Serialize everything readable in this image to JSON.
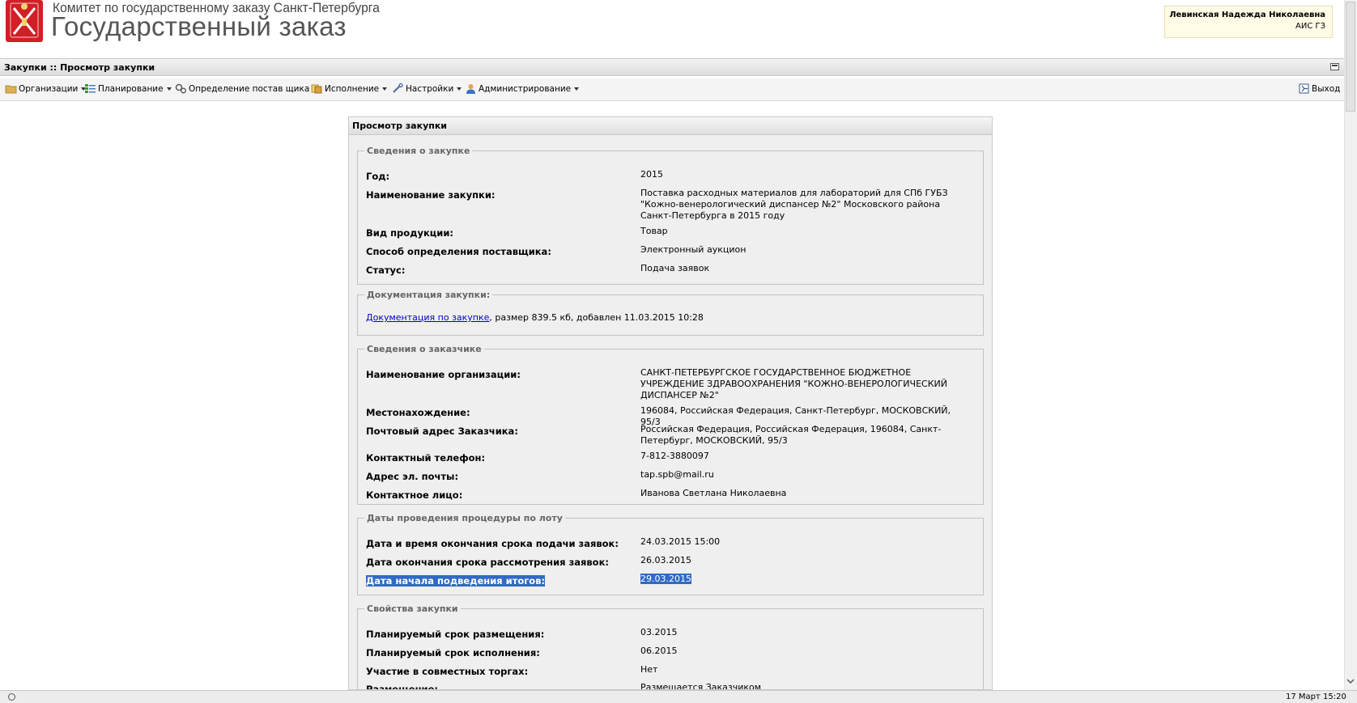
{
  "header": {
    "org_name": "Комитет по государственному заказу Санкт-Петербурга",
    "app_name": "Государственный заказ"
  },
  "user": {
    "name": "Левинская Надежда Николаевна",
    "system": "АИС ГЗ"
  },
  "breadcrumb": "Закупки :: Просмотр закупки",
  "menu": [
    {
      "label": "Организации",
      "icon": "folder-icon"
    },
    {
      "label": "Планирование",
      "icon": "list-icon"
    },
    {
      "label": "Определение постав щика",
      "icon": "gears-icon"
    },
    {
      "label": "Исполнение",
      "icon": "documents-icon"
    },
    {
      "label": "Настройки",
      "icon": "wrench-icon"
    },
    {
      "label": "Администрирование",
      "icon": "user-icon"
    }
  ],
  "exit_label": "Выход",
  "panel_title": "Просмотр закупки",
  "purchase": {
    "legend": "Сведения о закупке",
    "rows": [
      {
        "label": "Год:",
        "value": "2015"
      },
      {
        "label": "Наименование закупки:",
        "value": "Поставка расходных материалов для лабораторий для СПб ГУБЗ \"Кожно-венерологический диспансер №2\" Московского района Санкт-Петербурга в 2015 году"
      },
      {
        "label": "Вид продукции:",
        "value": "Товар"
      },
      {
        "label": "Способ определения поставщика:",
        "value": "Электронный аукцион"
      },
      {
        "label": "Статус:",
        "value": "Подача заявок"
      }
    ]
  },
  "documentation": {
    "legend": "Документация закупки:",
    "link": "Документация по закупке",
    "info": ", размер 839.5 кб, добавлен 11.03.2015 10:28"
  },
  "customer": {
    "legend": "Сведения о заказчике",
    "rows": [
      {
        "label": "Наименование организации:",
        "value": "САНКТ-ПЕТЕРБУРГСКОЕ ГОСУДАРСТВЕННОЕ БЮДЖЕТНОЕ УЧРЕЖДЕНИЕ ЗДРАВООХРАНЕНИЯ \"КОЖНО-ВЕНЕРОЛОГИЧЕСКИЙ ДИСПАНСЕР №2\""
      },
      {
        "label": "Местонахождение:",
        "value": "196084, Российская Федерация, Санкт-Петербург, МОСКОВСКИЙ, 95/3"
      },
      {
        "label": "Почтовый адрес Заказчика:",
        "value": "Российская Федерация, Российская Федерация, 196084, Санкт-Петербург, МОСКОВСКИЙ, 95/3"
      },
      {
        "label": "Контактный телефон:",
        "value": "7-812-3880097"
      },
      {
        "label": "Адрес эл. почты:",
        "value": "tap.spb@mail.ru"
      },
      {
        "label": "Контактное лицо:",
        "value": "Иванова Светлана Николаевна"
      }
    ]
  },
  "dates": {
    "legend": "Даты проведения процедуры по лоту",
    "rows": [
      {
        "label": "Дата и время окончания срока подачи заявок:",
        "value": "24.03.2015 15:00"
      },
      {
        "label": "Дата окончания срока рассмотрения заявок:",
        "value": "26.03.2015"
      },
      {
        "label": "Дата начала подведения итогов:",
        "value": "29.03.2015"
      }
    ]
  },
  "properties": {
    "legend": "Свойства закупки",
    "rows": [
      {
        "label": "Планируемый срок размещения:",
        "value": "03.2015"
      },
      {
        "label": "Планируемый срок исполнения:",
        "value": "06.2015"
      },
      {
        "label": "Участие в совместных торгах:",
        "value": "Нет"
      },
      {
        "label": "Размещение:",
        "value": "Размещается Заказчиком"
      }
    ]
  },
  "status_time": "17 Март 15:20"
}
